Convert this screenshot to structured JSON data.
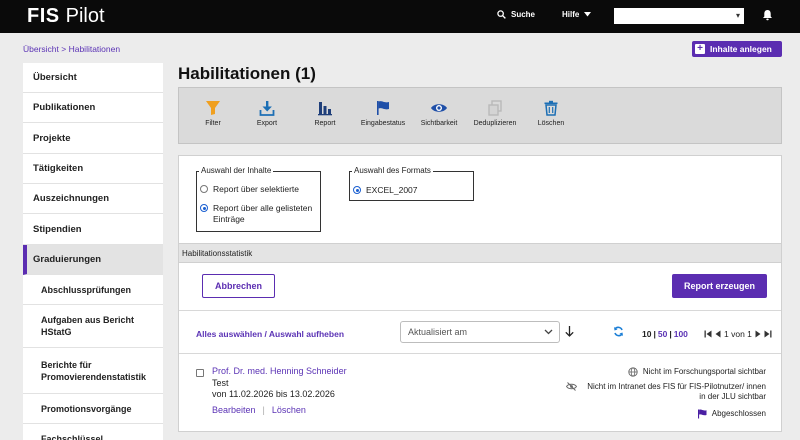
{
  "topbar": {
    "logo_bold": "FIS",
    "logo_light": "Pilot",
    "search_label": "Suche",
    "help_label": "Hilfe",
    "bg": "#0a0a0a"
  },
  "breadcrumb": "Übersicht > Habilitationen",
  "new_content_button": "Inhalte anlegen",
  "accent": "#5b2db1",
  "sidebar": {
    "items": [
      {
        "label": "Übersicht"
      },
      {
        "label": "Publikationen"
      },
      {
        "label": "Projekte"
      },
      {
        "label": "Tätigkeiten"
      },
      {
        "label": "Auszeichnungen"
      },
      {
        "label": "Stipendien"
      },
      {
        "label": "Graduierungen",
        "active": true
      },
      {
        "label": "Abschlussprüfungen"
      },
      {
        "label": "Aufgaben aus Bericht HStatG"
      },
      {
        "label": "Berichte für Promovierendenstatistik"
      },
      {
        "label": "Promotionsvorgänge"
      },
      {
        "label": "Fachschlüssel"
      }
    ]
  },
  "page_title": "Habilitationen (1)",
  "toolbar": {
    "tools": [
      {
        "label": "Filter",
        "icon": "filter-icon"
      },
      {
        "label": "Export",
        "icon": "download-icon"
      },
      {
        "label": "Report",
        "icon": "bar-chart-icon"
      },
      {
        "label": "Eingabestatus",
        "icon": "flag-icon"
      },
      {
        "label": "Sichtbarkeit",
        "icon": "eye-icon"
      },
      {
        "label": "Deduplizieren",
        "icon": "duplicate-icon",
        "disabled": true
      },
      {
        "label": "Löschen",
        "icon": "trash-icon"
      }
    ]
  },
  "report": {
    "content_legend": "Auswahl der Inhalte",
    "content_options": [
      {
        "label": "Report über selektierte",
        "checked": false
      },
      {
        "label": "Report über alle gelisteten Einträge",
        "checked": true
      }
    ],
    "format_legend": "Auswahl des Formats",
    "format_options": [
      {
        "label": "EXCEL_2007",
        "checked": true
      }
    ],
    "stats_label": "Habilitationsstatistik",
    "cancel_button": "Abbrechen",
    "create_button": "Report erzeugen"
  },
  "list_controls": {
    "select_all": "Alles auswählen",
    "separator": " / ",
    "deselect_all": "Auswahl aufheben",
    "sort_value": "Aktualisiert am",
    "page_sizes": [
      "10",
      "50",
      "100"
    ],
    "page_size_sep": "|",
    "page_info": "1 von 1"
  },
  "entries": [
    {
      "name": "Prof. Dr. med. Henning Schneider",
      "type": "Test",
      "date": "von 11.02.2026 bis 13.02.2026",
      "edit": "Bearbeiten",
      "delete": "Löschen",
      "status": [
        {
          "icon": "globe-icon",
          "text": "Nicht im Forschungsportal sichtbar"
        },
        {
          "icon": "eye-off-icon",
          "text": "Nicht im Intranet des FIS für FIS-Pilotnutzer/ innen in der JLU sichtbar"
        },
        {
          "icon": "flag-icon",
          "text": "Abgeschlossen"
        }
      ]
    }
  ]
}
